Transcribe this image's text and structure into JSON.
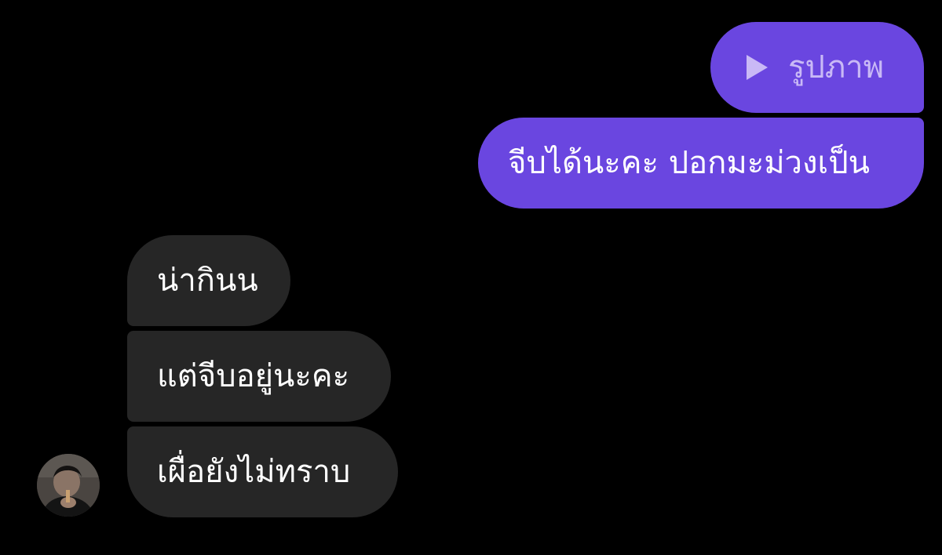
{
  "colors": {
    "background": "#000000",
    "outgoing_bubble": "#6a46e0",
    "incoming_bubble": "#262626",
    "reply_label_text": "#c9b9f6"
  },
  "outgoing": [
    {
      "icon": "play-icon",
      "text": "รูปภาพ"
    },
    {
      "text": "จีบได้นะคะ ปอกมะม่วงเป็น"
    }
  ],
  "incoming": [
    {
      "text": "น่ากินน"
    },
    {
      "text": "แต่จีบอยู่นะคะ"
    },
    {
      "text": "เผื่อยังไม่ทราบ"
    }
  ],
  "sender_avatar": {
    "icon": "profile-photo"
  }
}
